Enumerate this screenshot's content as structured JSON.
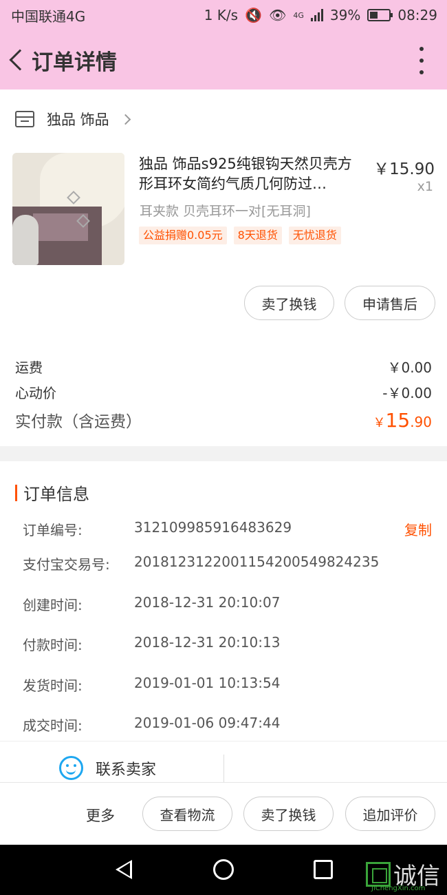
{
  "status_bar": {
    "carrier": "中国联通4G",
    "speed": "1 K/s",
    "network": "4G",
    "battery": "39%",
    "time": "08:29"
  },
  "header": {
    "title": "订单详情"
  },
  "shop": {
    "name": "独品  饰品"
  },
  "product": {
    "title": "独品 饰品s925纯银钩天然贝壳方形耳环女简约气质几何防过…",
    "price": "￥15.90",
    "quantity": "x1",
    "spec": "耳夹款 贝壳耳环一对[无耳洞]",
    "tags": [
      "公益捐赠0.05元",
      "8天退货",
      "无忧退货"
    ]
  },
  "item_actions": {
    "sell_exchange": "卖了换钱",
    "after_sale": "申请售后"
  },
  "fees": {
    "shipping_label": "运费",
    "shipping_value": "￥0.00",
    "heart_price_label": "心动价",
    "heart_price_value": "-￥0.00",
    "paid_label": "实付款（含运费）",
    "paid_currency": "￥",
    "paid_integer": "15",
    "paid_decimal": ".90"
  },
  "order_info": {
    "title": "订单信息",
    "order_no_label": "订单编号:",
    "order_no": "312109985916483629",
    "copy_label": "复制",
    "alipay_label": "支付宝交易号:",
    "alipay_no": "2018123122001154200549824235",
    "created_label": "创建时间:",
    "created": "2018-12-31 20:10:07",
    "paid_time_label": "付款时间:",
    "paid_time": "2018-12-31 20:10:13",
    "shipped_label": "发货时间:",
    "shipped": "2019-01-01 10:13:54",
    "completed_label": "成交时间:",
    "completed": "2019-01-06 09:47:44"
  },
  "contact": {
    "label": "联系卖家"
  },
  "bottom_bar": {
    "more": "更多",
    "logistics": "查看物流",
    "sell_exchange": "卖了换钱",
    "add_review": "追加评价"
  },
  "watermark": {
    "text": "诚信",
    "sub": "JiChengXin.com"
  },
  "colors": {
    "header_bg": "#f9c5e4",
    "accent": "#ff5000",
    "contact_icon": "#1ea7f0"
  }
}
